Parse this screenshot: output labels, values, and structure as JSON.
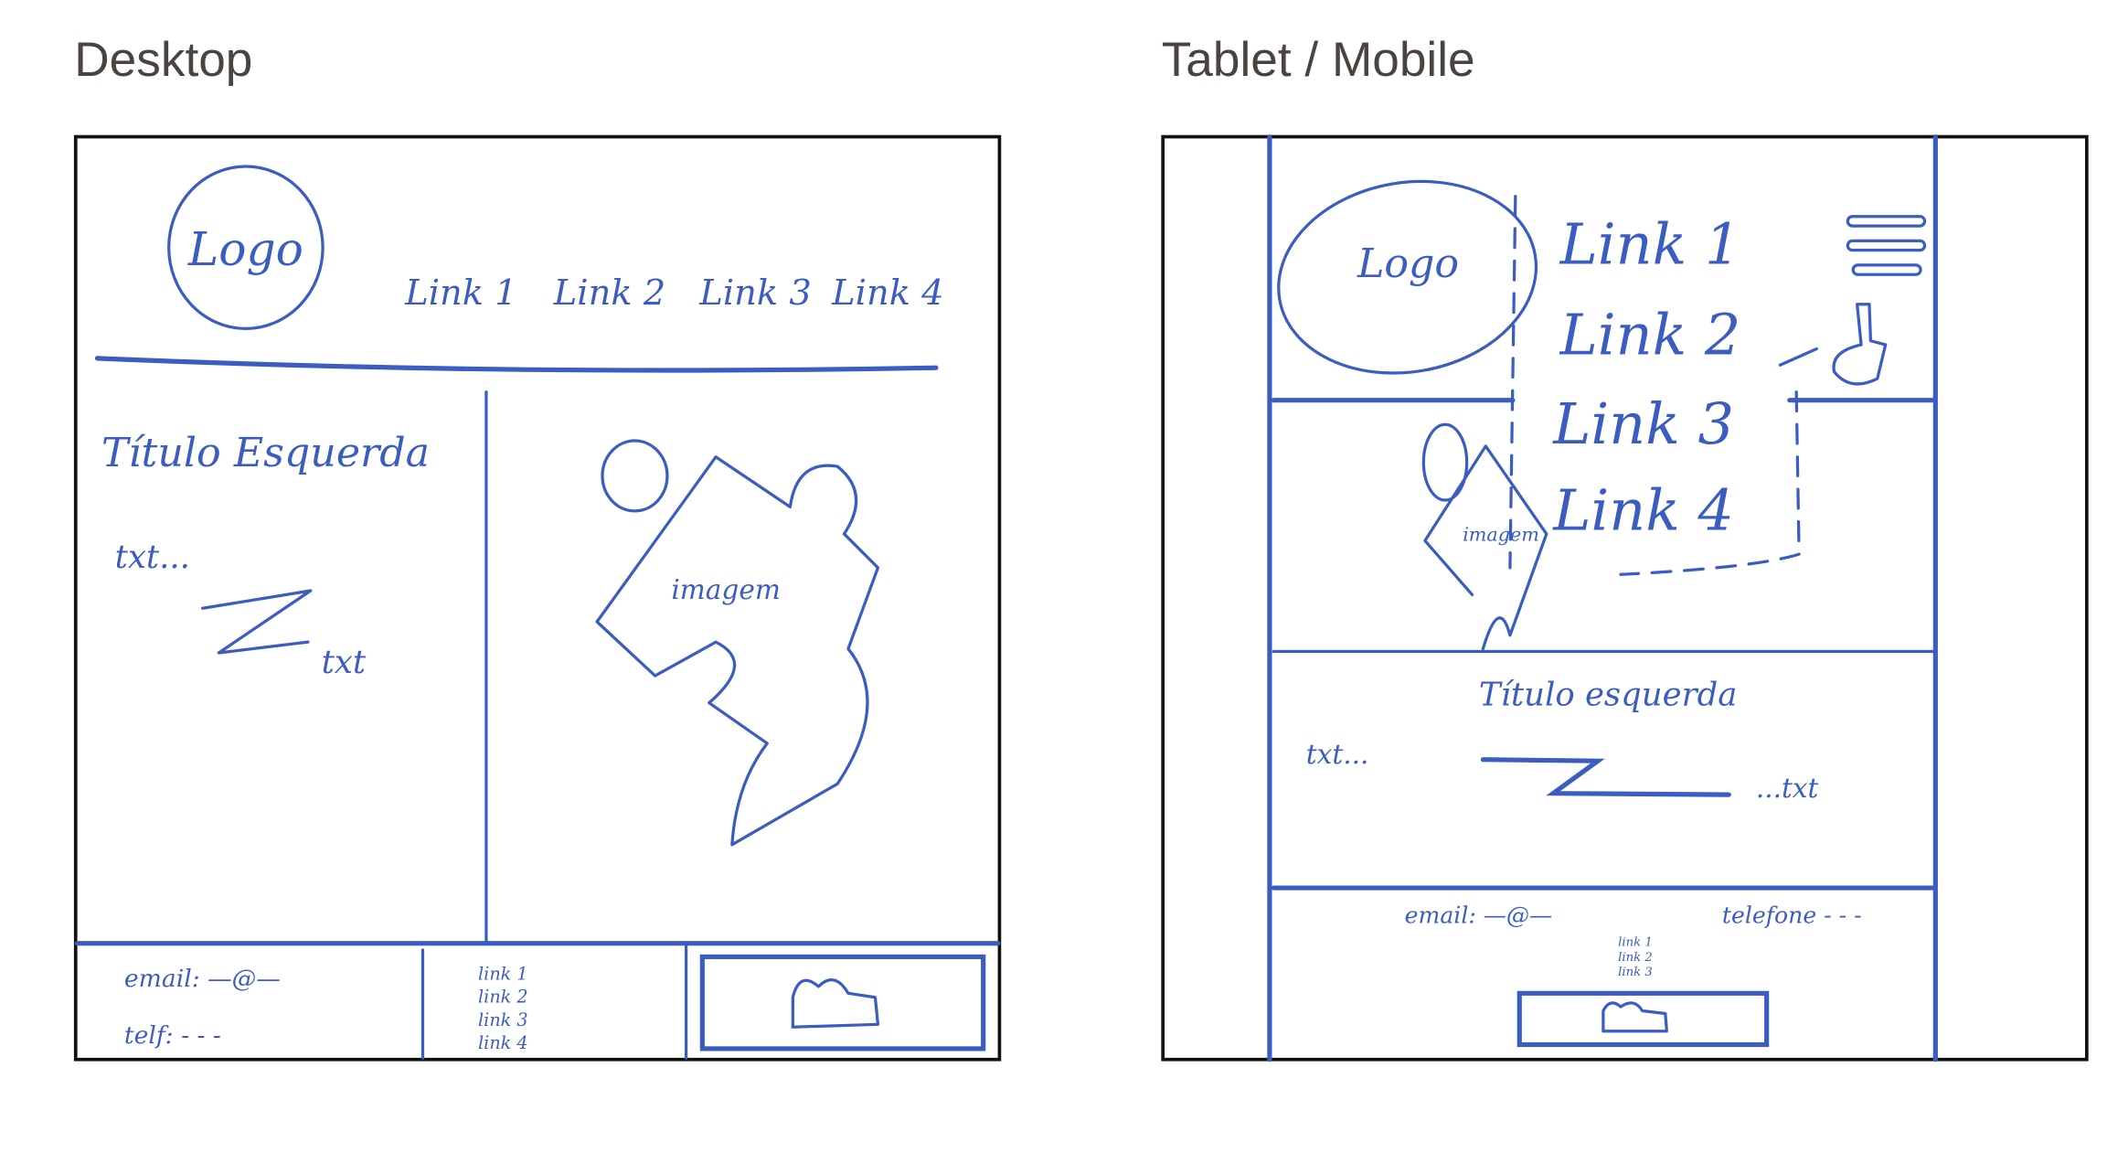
{
  "titles": {
    "desktop": "Desktop",
    "mobile": "Tablet / Mobile"
  },
  "ink_color": "#3b5cc0",
  "desktop": {
    "logo": "Logo",
    "links": [
      "Link 1",
      "Link 2",
      "Link 3",
      "Link 4"
    ],
    "heading": "Título Esquerda",
    "text_start": "txt...",
    "text_end": "txt",
    "image_label": "imagem",
    "footer": {
      "email": "email: —@—",
      "phone": "telf: - - -",
      "links": [
        "link 1",
        "link 2",
        "link 3",
        "link 4"
      ]
    }
  },
  "mobile": {
    "logo": "Logo",
    "links": [
      "Link 1",
      "Link 2",
      "Link 3",
      "Link 4"
    ],
    "image_label": "imagem",
    "heading": "Título esquerda",
    "text_start": "txt...",
    "text_end": "...txt",
    "footer": {
      "email": "email: —@—",
      "phone": "telefone - - -",
      "links": [
        "link 1",
        "link 2",
        "link 3"
      ]
    }
  }
}
